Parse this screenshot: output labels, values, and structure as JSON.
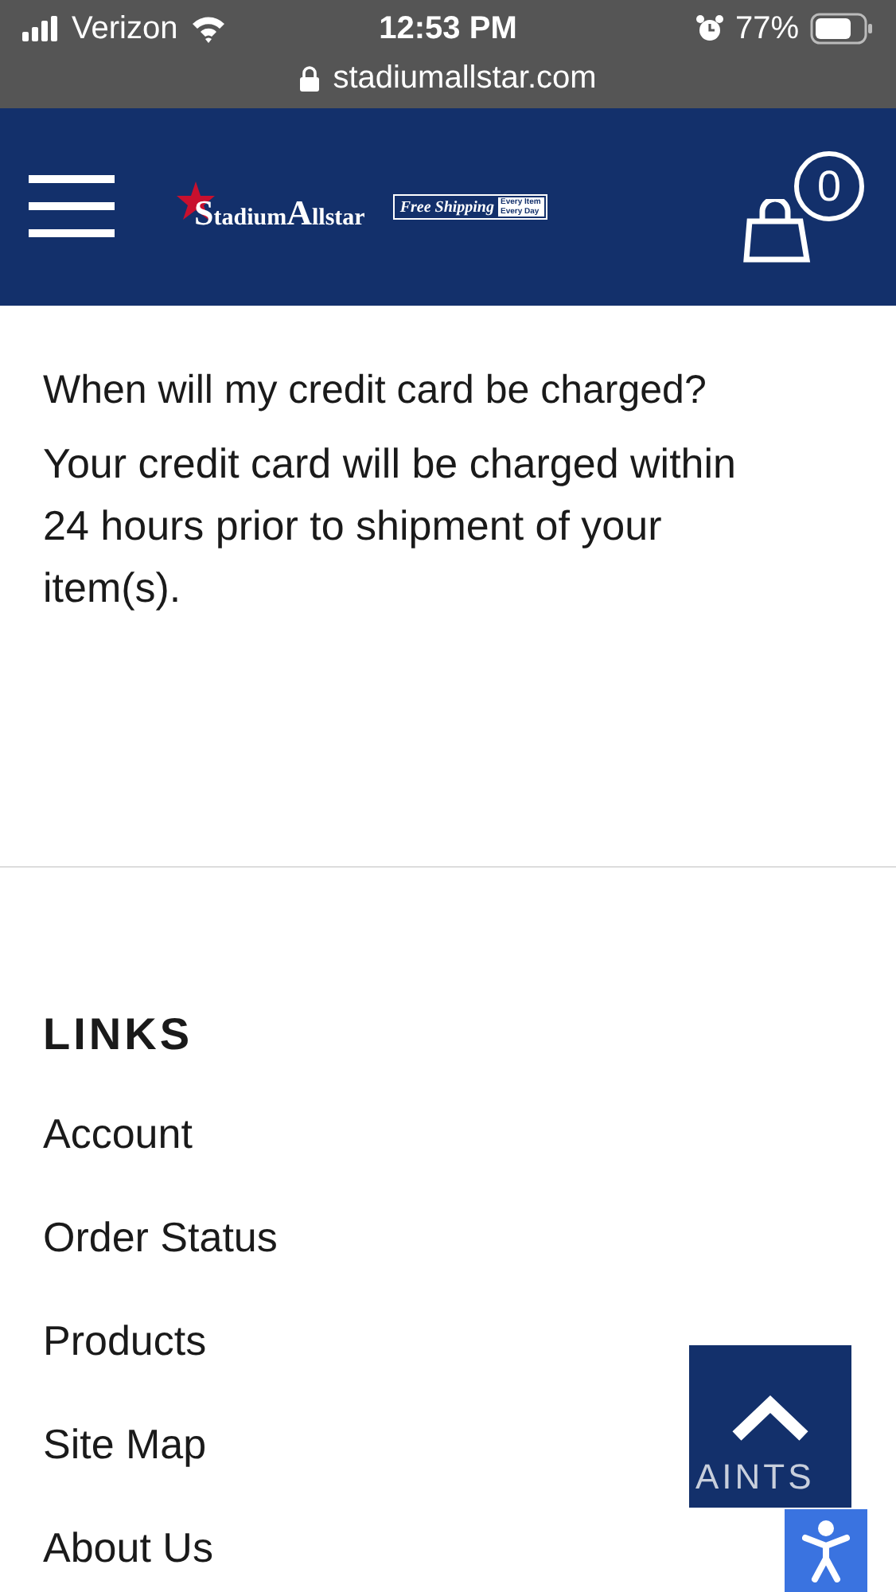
{
  "status_bar": {
    "carrier": "Verizon",
    "time": "12:53 PM",
    "battery": "77%",
    "url": "stadiumallstar.com"
  },
  "header": {
    "logo": {
      "first": "S",
      "first_rest": "tadium",
      "second": "A",
      "second_rest": "llstar"
    },
    "promo": {
      "main": "Free Shipping",
      "lines": [
        "Every Item",
        "Every Day"
      ]
    },
    "cart_count": "0"
  },
  "faq": {
    "question": "When will my credit card be charged?",
    "answer": "Your credit card will be charged within 24 hours prior to shipment of your item(s)."
  },
  "links": {
    "title": "LINKS",
    "items": [
      "Account",
      "Order Status",
      "Products",
      "Site Map",
      "About Us"
    ]
  },
  "overlay_text": "AINTS"
}
